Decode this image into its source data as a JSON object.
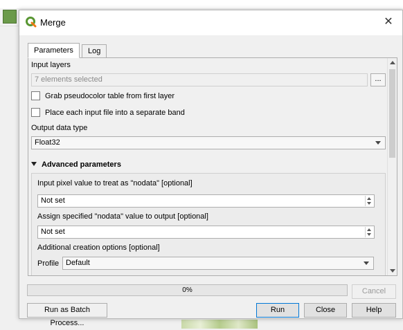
{
  "dialog": {
    "title": "Merge",
    "close_glyph": "✕",
    "icon": "qgis-logo-icon",
    "accent": "#589632"
  },
  "tabs": [
    {
      "label": "Parameters",
      "active": true
    },
    {
      "label": "Log",
      "active": false
    }
  ],
  "params": {
    "input_layers_label": "Input layers",
    "input_layers_value": "7 elements selected",
    "browse_label": "...",
    "grab_pseudocolor_label": "Grab pseudocolor table from first layer",
    "grab_pseudocolor_checked": false,
    "separate_band_label": "Place each input file into a separate band",
    "separate_band_checked": false,
    "output_type_label": "Output data type",
    "output_type_value": "Float32"
  },
  "advanced": {
    "header": "Advanced parameters",
    "nodata_label": "Input pixel value to treat as \"nodata\" [optional]",
    "nodata_value": "Not set",
    "assign_nodata_label": "Assign specified \"nodata\" value to output [optional]",
    "assign_nodata_value": "Not set",
    "creation_options_label": "Additional creation options [optional]",
    "profile_label": "Profile",
    "profile_value": "Default"
  },
  "progress": {
    "text": "0%",
    "fraction": 0
  },
  "buttons": {
    "cancel": "Cancel",
    "batch": "Run as Batch Process...",
    "run": "Run",
    "close": "Close",
    "help": "Help"
  }
}
